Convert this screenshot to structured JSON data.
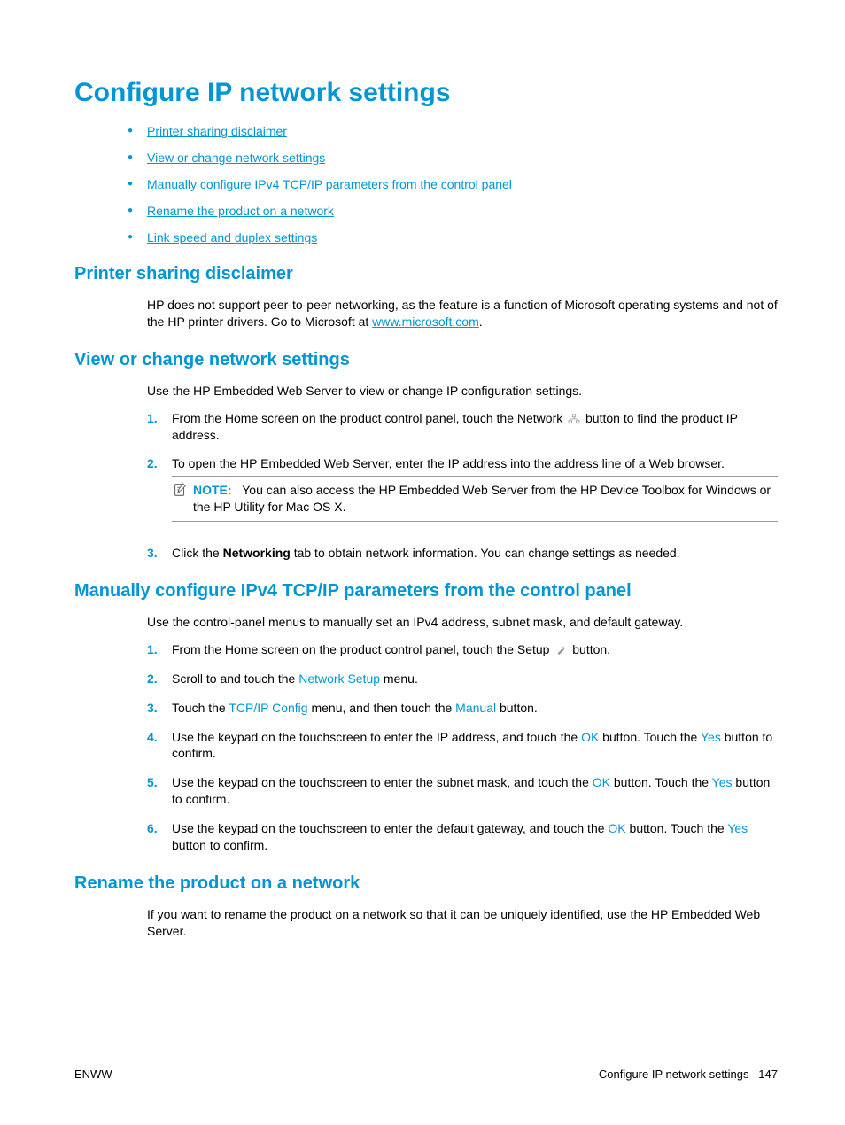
{
  "title": "Configure IP network settings",
  "toc": [
    "Printer sharing disclaimer",
    "View or change network settings",
    "Manually configure IPv4 TCP/IP parameters from the control panel",
    "Rename the product on a network",
    "Link speed and duplex settings"
  ],
  "s1": {
    "heading": "Printer sharing disclaimer",
    "p1a": "HP does not support peer-to-peer networking, as the feature is a function of Microsoft operating systems and not of the HP printer drivers. Go to Microsoft at ",
    "link": "www.microsoft.com",
    "p1b": "."
  },
  "s2": {
    "heading": "View or change network settings",
    "intro": "Use the HP Embedded Web Server to view or change IP configuration settings.",
    "step1a": "From the Home screen on the product control panel, touch the Network ",
    "step1b": " button to find the product IP address.",
    "step2": "To open the HP Embedded Web Server, enter the IP address into the address line of a Web browser.",
    "note_label": "NOTE:",
    "note_text": "You can also access the HP Embedded Web Server from the HP Device Toolbox for Windows or the HP Utility for Mac OS X.",
    "step3a": "Click the ",
    "step3b": "Networking",
    "step3c": " tab to obtain network information. You can change settings as needed."
  },
  "s3": {
    "heading": "Manually configure IPv4 TCP/IP parameters from the control panel",
    "intro": "Use the control-panel menus to manually set an IPv4 address, subnet mask, and default gateway.",
    "step1a": "From the Home screen on the product control panel, touch the Setup ",
    "step1b": " button.",
    "step2a": "Scroll to and touch the ",
    "step2b": "Network Setup",
    "step2c": " menu.",
    "step3a": "Touch the ",
    "step3b": "TCP/IP Config",
    "step3c": " menu, and then touch the ",
    "step3d": "Manual",
    "step3e": " button.",
    "step4a": "Use the keypad on the touchscreen to enter the IP address, and touch the ",
    "step4b": "OK",
    "step4c": " button. Touch the ",
    "step4d": "Yes",
    "step4e": " button to confirm.",
    "step5a": "Use the keypad on the touchscreen to enter the subnet mask, and touch the ",
    "step5b": "OK",
    "step5c": " button. Touch the ",
    "step5d": "Yes",
    "step5e": " button to confirm.",
    "step6a": "Use the keypad on the touchscreen to enter the default gateway, and touch the ",
    "step6b": "OK",
    "step6c": " button. Touch the ",
    "step6d": "Yes",
    "step6e": " button to confirm."
  },
  "s4": {
    "heading": "Rename the product on a network",
    "p1": "If you want to rename the product on a network so that it can be uniquely identified, use the HP Embedded Web Server."
  },
  "footer": {
    "left": "ENWW",
    "right_label": "Configure IP network settings",
    "right_page": "147"
  }
}
